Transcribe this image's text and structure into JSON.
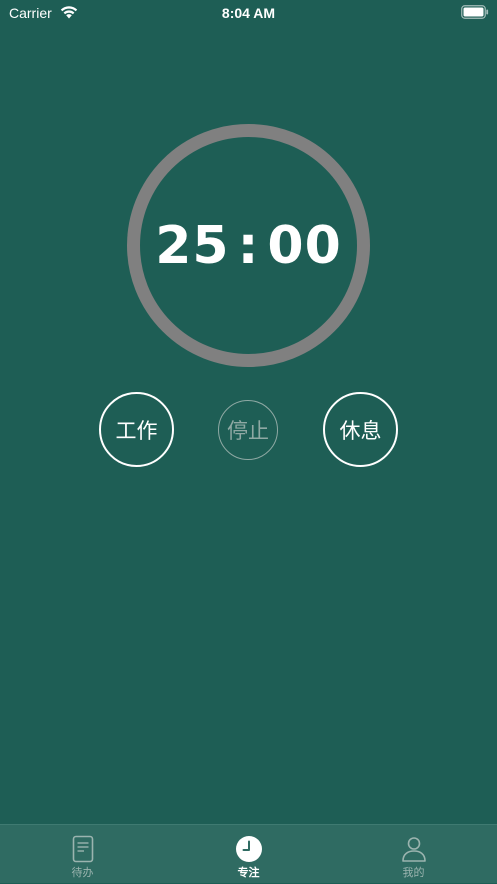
{
  "status_bar": {
    "carrier": "Carrier",
    "time": "8:04 AM",
    "wifi_icon": "wifi-icon",
    "battery_icon": "battery-full-icon"
  },
  "timer": {
    "minutes": "25",
    "separator": ":",
    "seconds": "00",
    "ring_color": "#808080",
    "progress": 0
  },
  "controls": {
    "work_label": "工作",
    "stop_label": "停止",
    "rest_label": "休息",
    "stop_enabled": false
  },
  "tab_bar": {
    "tabs": [
      {
        "label": "待办",
        "icon": "document-icon",
        "active": false
      },
      {
        "label": "专注",
        "icon": "clock-icon",
        "active": true
      },
      {
        "label": "我的",
        "icon": "person-icon",
        "active": false
      }
    ]
  },
  "colors": {
    "background": "#1e5e55",
    "tab_bar_background": "#2f6b62",
    "active": "#ffffff",
    "inactive": "#9bb4af"
  }
}
